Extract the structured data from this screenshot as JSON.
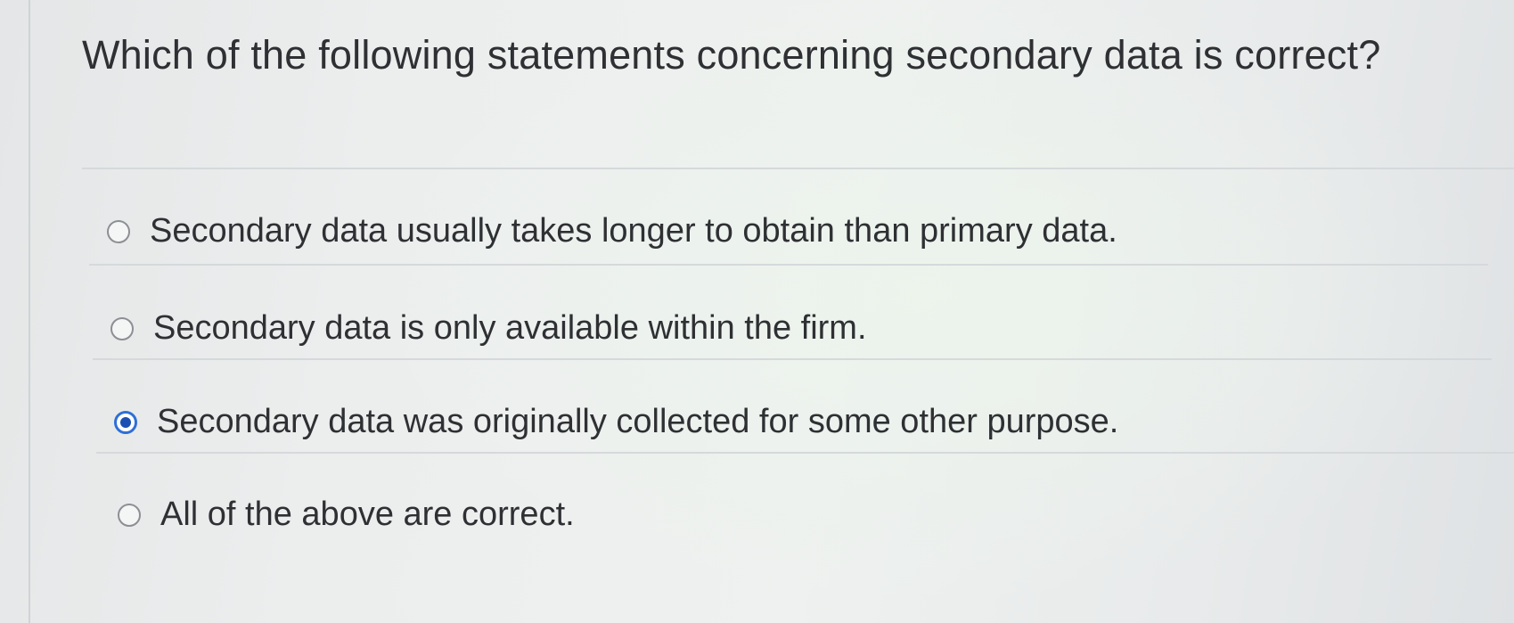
{
  "question": {
    "text": "Which of the following statements concerning secondary data is correct?"
  },
  "options": [
    {
      "label": "Secondary data usually takes longer to obtain than primary data.",
      "selected": false
    },
    {
      "label": "Secondary data is only available within the firm.",
      "selected": false
    },
    {
      "label": "Secondary data was originally collected for some other purpose.",
      "selected": true
    },
    {
      "label": "All of the above are correct.",
      "selected": false
    }
  ],
  "colors": {
    "selected_radio": "#1b4fb3",
    "text": "#2e3033"
  }
}
